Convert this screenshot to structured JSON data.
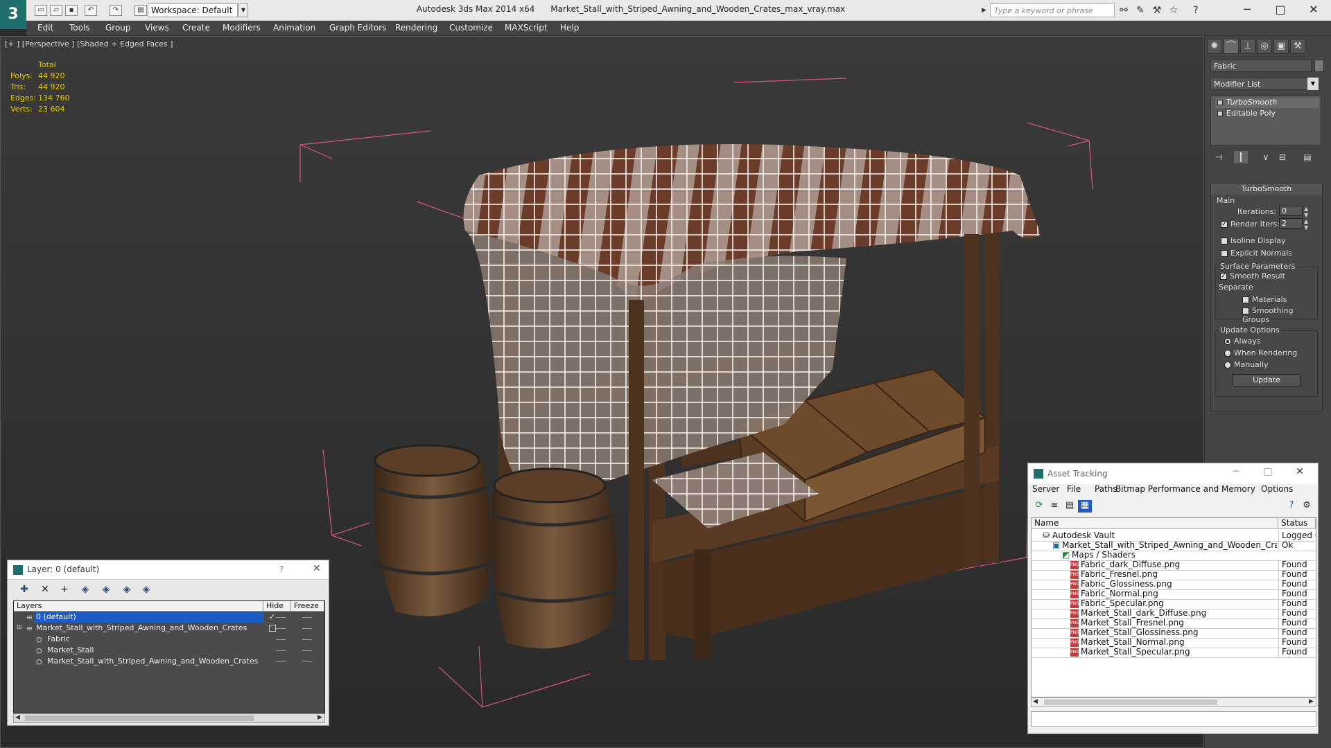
{
  "titlebar": {
    "workspace": "Workspace: Default",
    "app": "Autodesk 3ds Max  2014 x64",
    "file": "Market_Stall_with_Striped_Awning_and_Wooden_Crates_max_vray.max",
    "search_placeholder": "Type a keyword or phrase"
  },
  "menu": [
    "Edit",
    "Tools",
    "Group",
    "Views",
    "Create",
    "Modifiers",
    "Animation",
    "Graph Editors",
    "Rendering",
    "Customize",
    "MAXScript",
    "Help"
  ],
  "viewport": {
    "label": "[+ ] [Perspective ] [Shaded + Edged Faces ]",
    "stats": {
      "header": "Total",
      "rows": [
        {
          "label": "Polys:",
          "value": "44 920"
        },
        {
          "label": "Tris:",
          "value": "44 920"
        },
        {
          "label": "Edges:",
          "value": "134 760"
        },
        {
          "label": "Verts:",
          "value": "23 604"
        }
      ]
    }
  },
  "command_panel": {
    "object_name": "Fabric",
    "modifier_list": "Modifier List",
    "stack": [
      "TurboSmooth",
      "Editable Poly"
    ],
    "rollout_title": "TurboSmooth",
    "main_label": "Main",
    "iterations_label": "Iterations:",
    "iterations_value": "0",
    "render_iters_label": "Render Iters:",
    "render_iters_value": "2",
    "isoline": "Isoline Display",
    "explicit_normals": "Explicit Normals",
    "surface_params": "Surface Parameters",
    "smooth_result": "Smooth Result",
    "separate": "Separate",
    "materials": "Materials",
    "smoothing_groups": "Smoothing Groups",
    "update_options": "Update Options",
    "always": "Always",
    "when_rendering": "When Rendering",
    "manually": "Manually",
    "update_button": "Update"
  },
  "layer_window": {
    "title": "Layer: 0 (default)",
    "help": "?",
    "columns": [
      "Layers",
      "Hide",
      "Freeze"
    ],
    "rows": [
      {
        "name": "0 (default)",
        "selected": true
      },
      {
        "name": "Market_Stall_with_Striped_Awning_and_Wooden_Crates",
        "selected": false
      },
      {
        "name": "Fabric",
        "selected": false
      },
      {
        "name": "Market_Stall",
        "selected": false
      },
      {
        "name": "Market_Stall_with_Striped_Awning_and_Wooden_Crates",
        "selected": false
      }
    ]
  },
  "asset_window": {
    "title": "Asset Tracking",
    "menu": [
      "Server",
      "File",
      "Paths",
      "Bitmap Performance and Memory",
      "Options"
    ],
    "columns": [
      "Name",
      "Status"
    ],
    "rows": [
      {
        "name": "Autodesk Vault",
        "status": "Logged Out"
      },
      {
        "name": "Market_Stall_with_Striped_Awning_and_Wooden_Crate...",
        "status": "Ok"
      },
      {
        "name": "Maps / Shaders",
        "status": ""
      },
      {
        "name": "Fabric_dark_Diffuse.png",
        "status": "Found"
      },
      {
        "name": "Fabric_Fresnel.png",
        "status": "Found"
      },
      {
        "name": "Fabric_Glossiness.png",
        "status": "Found"
      },
      {
        "name": "Fabric_Normal.png",
        "status": "Found"
      },
      {
        "name": "Fabric_Specular.png",
        "status": "Found"
      },
      {
        "name": "Market_Stall_dark_Diffuse.png",
        "status": "Found"
      },
      {
        "name": "Market_Stall_Fresnel.png",
        "status": "Found"
      },
      {
        "name": "Market_Stall_Glossiness.png",
        "status": "Found"
      },
      {
        "name": "Market_Stall_Normal.png",
        "status": "Found"
      },
      {
        "name": "Market_Stall_Specular.png",
        "status": "Found"
      }
    ]
  },
  "colors": {
    "accent": "#1f6f6c",
    "stats_text": "#e8c800",
    "selection": "#1e5bc6",
    "bbox": "#d9538a",
    "wood": "#5b3a22",
    "fabric_stripe": "#6b3c2a"
  }
}
